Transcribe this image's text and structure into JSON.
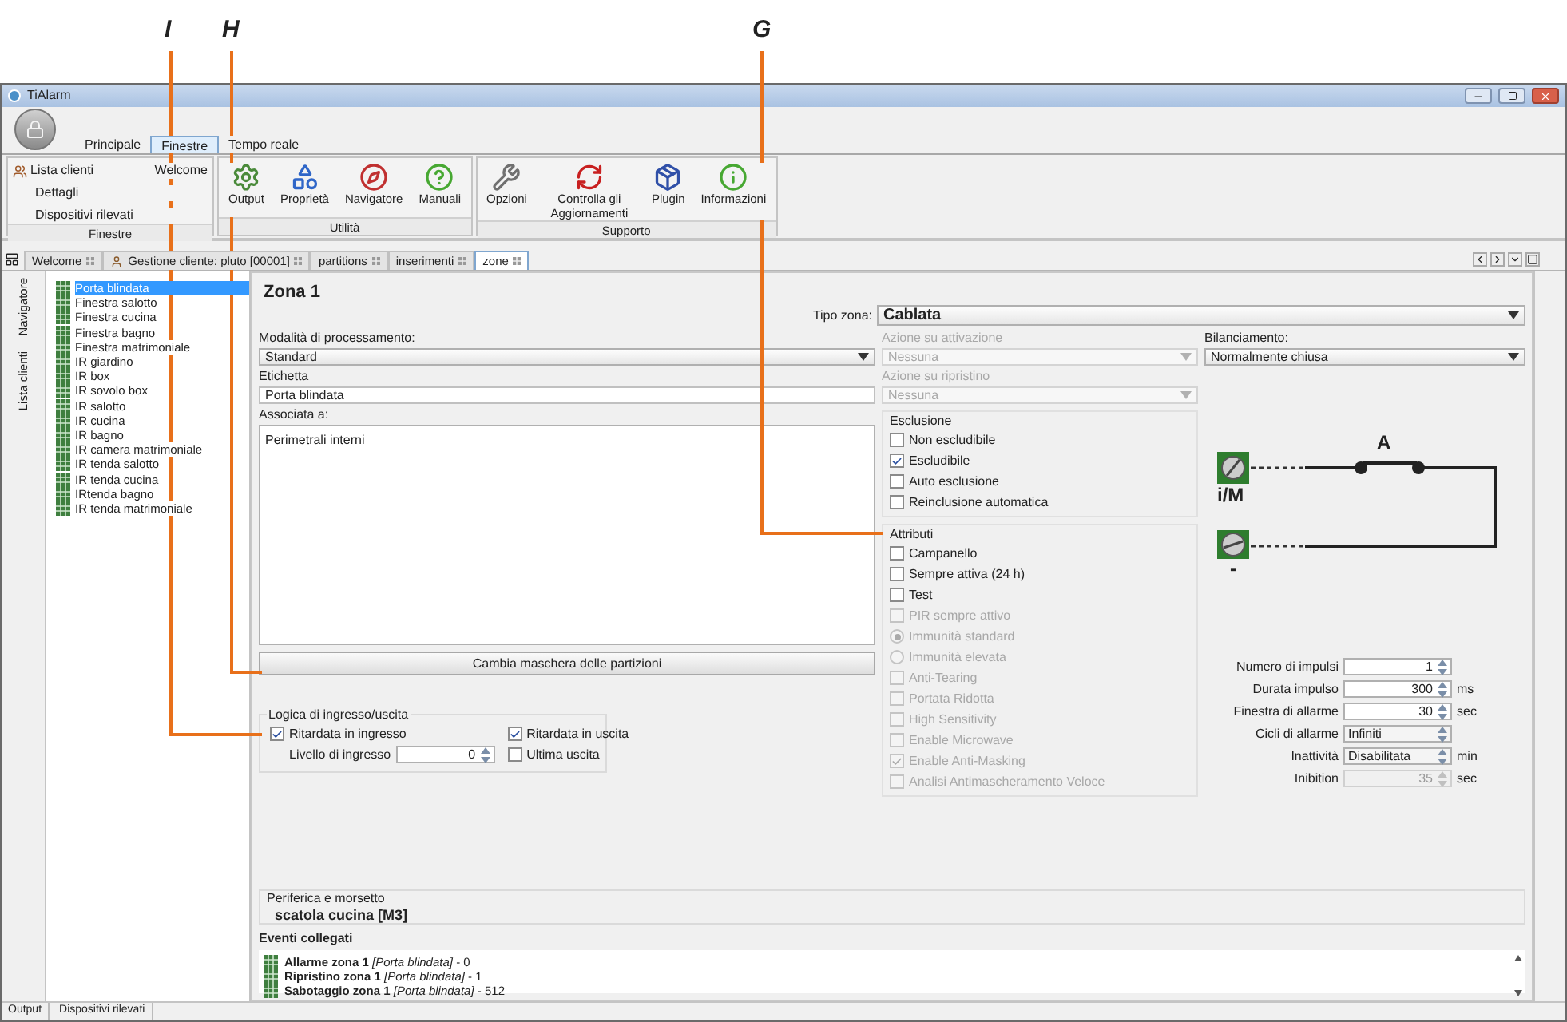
{
  "window": {
    "title": "TiAlarm"
  },
  "ribbon_tabs": [
    {
      "label": "Principale",
      "selected": false
    },
    {
      "label": "Finestre",
      "selected": true
    },
    {
      "label": "Tempo reale",
      "selected": false
    }
  ],
  "ribbon_groups": [
    {
      "title": "Finestre",
      "kind": "list",
      "items": [
        "Lista clienti",
        "Welcome",
        "Dettagli",
        "Dispositivi rilevati"
      ]
    },
    {
      "title": "Utilità",
      "kind": "large",
      "items": [
        "Output",
        "Proprietà",
        "Navigatore",
        "Manuali"
      ]
    },
    {
      "title": "Supporto",
      "kind": "large",
      "items": [
        "Opzioni",
        "Controlla gli Aggiornamenti",
        "Plugin",
        "Informazioni"
      ]
    }
  ],
  "doc_tabs": [
    {
      "label": "Welcome",
      "selected": false
    },
    {
      "label": "Gestione cliente: pluto [00001]",
      "selected": false
    },
    {
      "label": "partitions",
      "selected": false
    },
    {
      "label": "inserimenti",
      "selected": false
    },
    {
      "label": "zone",
      "selected": true
    }
  ],
  "side_tabs": [
    "Navigatore",
    "Lista clienti"
  ],
  "zone_tree": [
    {
      "label": "Porta blindata",
      "selected": true
    },
    {
      "label": "Finestra salotto",
      "selected": false
    },
    {
      "label": "Finestra cucina",
      "selected": false
    },
    {
      "label": "Finestra bagno",
      "selected": false
    },
    {
      "label": "Finestra matrimoniale",
      "selected": false
    },
    {
      "label": "IR giardino",
      "selected": false
    },
    {
      "label": "IR box",
      "selected": false
    },
    {
      "label": "IR sovolo box",
      "selected": false
    },
    {
      "label": "IR salotto",
      "selected": false
    },
    {
      "label": "IR cucina",
      "selected": false
    },
    {
      "label": "IR bagno",
      "selected": false
    },
    {
      "label": "IR camera matrimoniale",
      "selected": false
    },
    {
      "label": "IR tenda salotto",
      "selected": false
    },
    {
      "label": "IR tenda cucina",
      "selected": false
    },
    {
      "label": "IRtenda bagno",
      "selected": false
    },
    {
      "label": "IR tenda matrimoniale",
      "selected": false
    }
  ],
  "form": {
    "title": "Zona 1",
    "tipo_zona": {
      "label": "Tipo zona:",
      "value": "Cablata"
    },
    "modalita": {
      "label": "Modalità di processamento:",
      "value": "Standard"
    },
    "etichetta": {
      "label": "Etichetta",
      "value": "Porta blindata"
    },
    "associata": {
      "label": "Associata a:",
      "value": "Perimetrali interni"
    },
    "partition_button": "Cambia maschera delle partizioni",
    "logica": {
      "title": "Logica di ingresso/uscita",
      "ritardata_ingresso": {
        "label": "Ritardata in ingresso",
        "checked": true
      },
      "ritardata_uscita": {
        "label": "Ritardata in uscita",
        "checked": true
      },
      "livello": {
        "label": "Livello di ingresso",
        "value": "0"
      },
      "ultima_uscita": {
        "label": "Ultima uscita",
        "checked": false
      }
    },
    "azione_attivazione": {
      "label": "Azione su attivazione",
      "value": "Nessuna",
      "disabled": true
    },
    "azione_ripristino": {
      "label": "Azione su ripristino",
      "value": "Nessuna",
      "disabled": true
    },
    "esclusione": {
      "title": "Esclusione",
      "options": [
        {
          "label": "Non escludibile",
          "checked": false
        },
        {
          "label": "Escludibile",
          "checked": true
        },
        {
          "label": "Auto esclusione",
          "checked": false
        },
        {
          "label": "Reinclusione automatica",
          "checked": false
        }
      ]
    },
    "attributi": {
      "title": "Attributi",
      "items": [
        {
          "kind": "checkbox",
          "label": "Campanello",
          "checked": false,
          "disabled": false
        },
        {
          "kind": "checkbox",
          "label": "Sempre attiva (24 h)",
          "checked": false,
          "disabled": false
        },
        {
          "kind": "checkbox",
          "label": "Test",
          "checked": false,
          "disabled": false
        },
        {
          "kind": "checkbox",
          "label": "PIR sempre attivo",
          "checked": false,
          "disabled": true
        },
        {
          "kind": "radio",
          "label": "Immunità standard",
          "checked": true,
          "disabled": true
        },
        {
          "kind": "radio",
          "label": "Immunità elevata",
          "checked": false,
          "disabled": true
        },
        {
          "kind": "checkbox",
          "label": "Anti-Tearing",
          "checked": false,
          "disabled": true
        },
        {
          "kind": "checkbox",
          "label": "Portata Ridotta",
          "checked": false,
          "disabled": true
        },
        {
          "kind": "checkbox",
          "label": "High Sensitivity",
          "checked": false,
          "disabled": true
        },
        {
          "kind": "checkbox",
          "label": "Enable Microwave",
          "checked": false,
          "disabled": true
        },
        {
          "kind": "checkbox",
          "label": "Enable Anti-Masking",
          "checked": true,
          "disabled": true
        },
        {
          "kind": "checkbox",
          "label": "Analisi Antimascheramento Veloce",
          "checked": false,
          "disabled": true
        }
      ]
    },
    "bilanciamento": {
      "label": "Bilanciamento:",
      "value": "Normalmente chiusa"
    },
    "diagram": {
      "contact": "A",
      "terminal_top": "i/M",
      "terminal_bottom": "-"
    },
    "timing": [
      {
        "kind": "number",
        "label": "Numero di impulsi",
        "value": "1",
        "disabled": false
      },
      {
        "kind": "number",
        "label": "Durata impulso",
        "value": "300",
        "unit": "ms",
        "disabled": false
      },
      {
        "kind": "number",
        "label": "Finestra di allarme",
        "value": "30",
        "unit": "sec",
        "disabled": false
      },
      {
        "kind": "text",
        "label": "Cicli di allarme",
        "value": "Infiniti",
        "disabled": false
      },
      {
        "kind": "text",
        "label": "Inattività",
        "value": "Disabilitata",
        "unit": "min",
        "disabled": false
      },
      {
        "kind": "number",
        "label": "Inibition",
        "value": "35",
        "unit": "sec",
        "disabled": true
      }
    ],
    "periferica": {
      "label": "Periferica e morsetto",
      "value": "scatola cucina [M3]"
    },
    "eventi": {
      "title": "Eventi collegati",
      "items": [
        "**Allarme zona 1** *[Porta blindata]* - 0",
        "**Ripristino zona 1** *[Porta blindata]* - 1",
        "**Sabotaggio zona 1** *[Porta blindata]* - 512"
      ]
    }
  },
  "status_bar": [
    "Output",
    "Dispositivi rilevati"
  ],
  "callouts": [
    {
      "label": "I"
    },
    {
      "label": "H"
    },
    {
      "label": "G"
    }
  ]
}
